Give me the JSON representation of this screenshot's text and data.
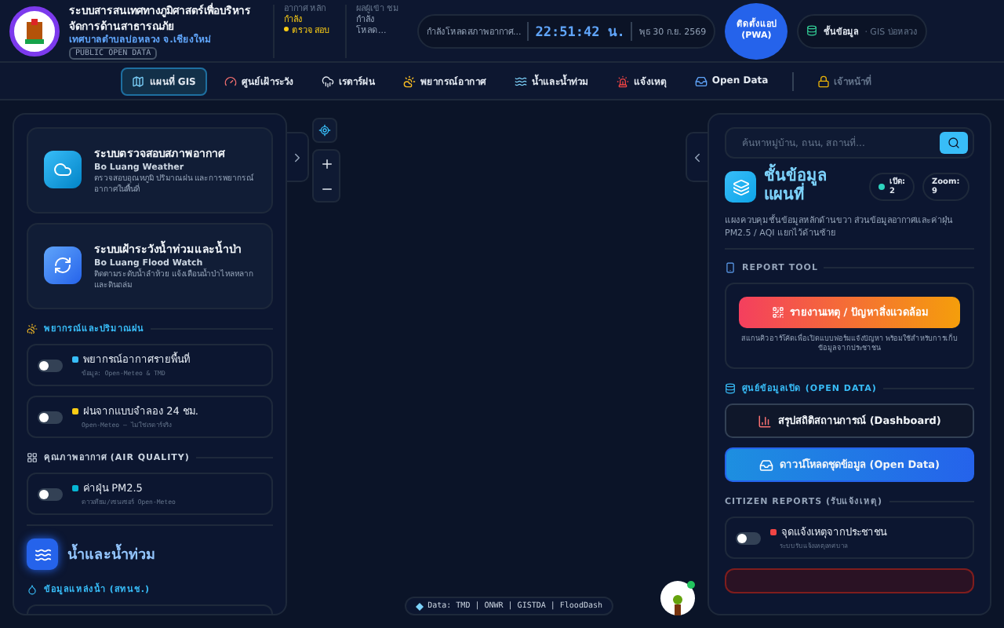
{
  "header": {
    "title": "ระบบสารสนเทศทางภูมิศาสตร์เพื่อบริหารจัดการด้านสาธารณภัย",
    "subtitle": "เทศบาลตำบลบ่อหลวง จ.เชียงใหม่",
    "badge": "PUBLIC OPEN DATA",
    "status_columns": [
      {
        "label": "อากาศ หลัก",
        "status": "กำลัง",
        "detail": "ตรวจ สอบ",
        "dot": true
      },
      {
        "label": "ผลผู้เข้า ชม",
        "status": "กำลัง",
        "detail": "โหลด...",
        "dot": false
      }
    ],
    "weather": "กำลังโหลดสภาพอากาศ...",
    "clock": "22:51:42 น.",
    "date": "พุธ 30 ก.ย. 2569",
    "install_button": "ติดตั้งแอป (PWA)",
    "layer_chip": "ชั้นข้อมูล",
    "layer_chip_sub": "· GIS บ่อหลวง"
  },
  "nav": [
    {
      "label": "แผนที่ GIS",
      "kind": "map",
      "selected": true
    },
    {
      "label": "ศูนย์เฝ้าระวัง",
      "kind": "gauge",
      "selected": false
    },
    {
      "label": "เรดาร์ฝน",
      "kind": "rain",
      "selected": false
    },
    {
      "label": "พยากรณ์อากาศ",
      "kind": "sun",
      "selected": false
    },
    {
      "label": "น้ำและน้ำท่วม",
      "kind": "wave",
      "selected": false
    },
    {
      "label": "แจ้งเหตุ",
      "kind": "alert",
      "selected": false
    },
    {
      "label": "Open Data",
      "kind": "inbox",
      "selected": false
    },
    {
      "label": "เจ้าหน้าที่",
      "kind": "lock",
      "selected": false
    }
  ],
  "left_panel": {
    "systems": [
      {
        "kind": "weather",
        "title": "ระบบตรวจสอบสภาพอากาศ",
        "subtitle": "Bo Luang Weather",
        "description": "ตรวจสอบอุณหภูมิ ปริมาณฝน และการพยากรณ์อากาศในพื้นที่"
      },
      {
        "kind": "flood",
        "title": "ระบบเฝ้าระวังน้ำท่วมและน้ำป่า",
        "subtitle": "Bo Luang Flood Watch",
        "description": "ติดตามระดับน้ำลำห้วย แจ้งเตือนน้ำป่าไหลหลาก และดินถล่ม"
      }
    ],
    "sections": [
      {
        "kind": "forecast",
        "title": "พยากรณ์และปริมาณฝน",
        "layers": [
          {
            "name": "พยากรณ์อากาศรายพื้นที่",
            "source": "ข้อมูล: Open-Meteo & TMD",
            "color": "#38bdf8",
            "on": false
          },
          {
            "name": "ฝนจากแบบจำลอง 24 ชม.",
            "source": "Open-Meteo — ไม่ใช่เรดาร์จริง",
            "color": "#facc15",
            "on": false
          }
        ]
      },
      {
        "kind": "air",
        "title": "คุณภาพอากาศ (AIR QUALITY)",
        "layers": [
          {
            "name": "ค่าฝุ่น PM2.5",
            "source": "ดาวเทียม/เซนเซอร์ Open-Meteo",
            "color": "#06b6d4",
            "on": false
          }
        ]
      }
    ],
    "group_title": "น้ำและน้ำท่วม",
    "group_section": "ข้อมูลแหล่งน้ำ (สทนช.)"
  },
  "attribution": "Data: TMD | ONWR | GISTDA | FloodDash",
  "right_panel": {
    "search": {
      "placeholder": "ค้นหาหมู่บ้าน, ถนน, สถานที่..."
    },
    "title": "ชั้นข้อมูล แผนที่",
    "stats": [
      {
        "label": "เปิด:",
        "value": "2"
      },
      {
        "label": "Zoom:",
        "value": "9"
      }
    ],
    "description": "แผงควบคุมชั้นข้อมูลหลักด้านขวา ส่วนข้อมูลอากาศและค่าฝุ่น PM2.5 / AQI แยกไว้ด้านซ้าย",
    "report_section": "REPORT TOOL",
    "report_button": "รายงานเหตุ / ปัญหาสิ่งแวดล้อม",
    "report_note": "สแกนคิวอาร์โค้ดเพื่อเปิดแบบฟอร์มแจ้งปัญหา พร้อมใช้สำหรับการเก็บข้อมูลจากประชาชน",
    "open_data_section": "ศูนย์ข้อมูลเปิด (OPEN DATA)",
    "dashboard_button": "สรุปสถิติสถานการณ์ (Dashboard)",
    "download_button": "ดาวน์โหลดชุดข้อมูล (Open Data)",
    "citizen_section": "CITIZEN REPORTS (รับแจ้งเหตุ)",
    "citizen_layers": [
      {
        "name": "จุดแจ้งเหตุจากประชาชน",
        "source": "ระบบรับแจ้งเหตุเทศบาล",
        "color": "#ef4444",
        "on": false
      }
    ]
  }
}
